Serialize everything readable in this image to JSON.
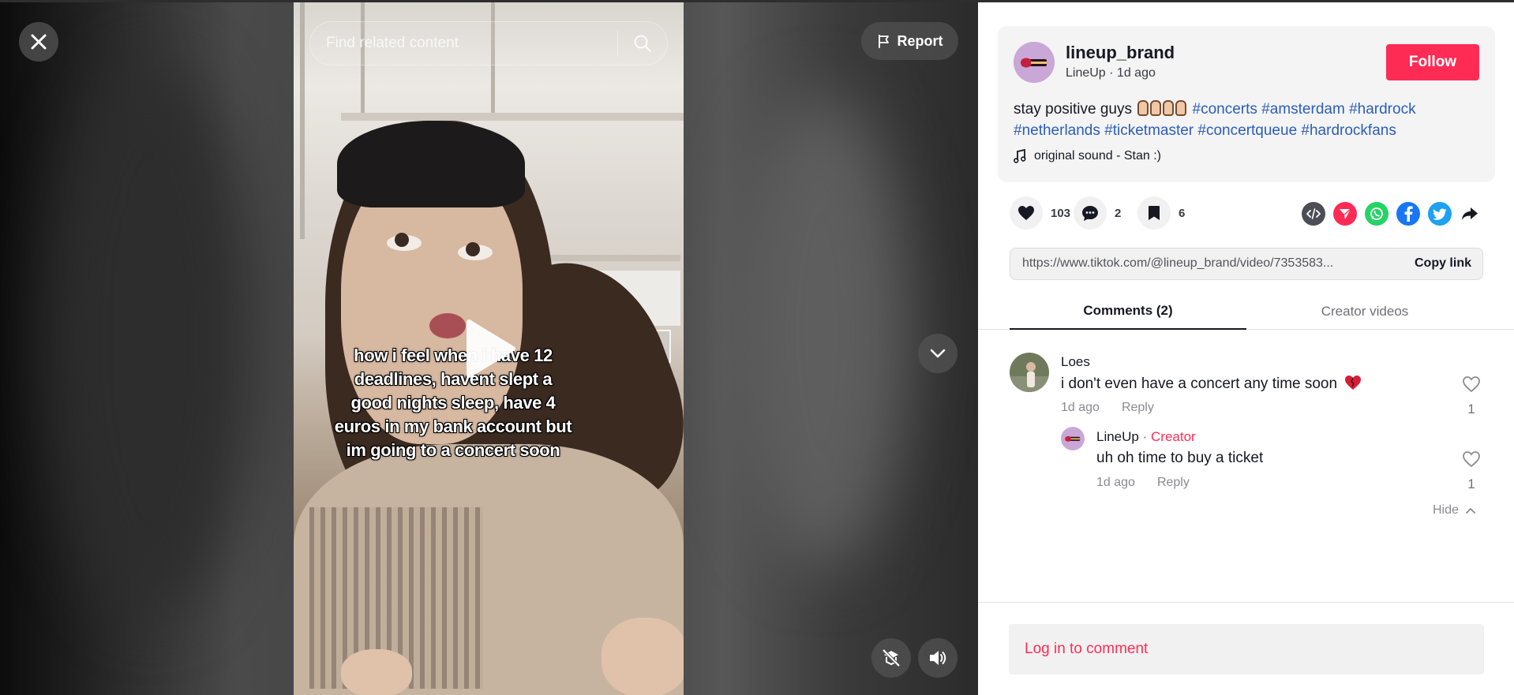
{
  "video": {
    "search_placeholder": "Find related content",
    "report_label": "Report",
    "caption": "how i feel when i have 12 deadlines, havent slept a good nights sleep, have 4 euros in my bank account but im going to a concert soon"
  },
  "post": {
    "author_handle": "lineup_brand",
    "author_sub": "LineUp · 1d ago",
    "follow_label": "Follow",
    "description_text": "stay positive guys",
    "hashtags": [
      "#concerts",
      "#amsterdam",
      "#hardrock",
      "#netherlands",
      "#ticketmaster",
      "#concertqueue",
      "#hardrockfans"
    ],
    "sound": "original sound - Stan :)"
  },
  "actions": {
    "likes": "103",
    "comments": "2",
    "saves": "6",
    "share_icons": [
      "embed-icon",
      "send-icon",
      "whatsapp-icon",
      "facebook-icon",
      "twitter-icon",
      "share-arrow-icon"
    ]
  },
  "link": {
    "url": "https://www.tiktok.com/@lineup_brand/video/7353583...",
    "copy_label": "Copy link"
  },
  "tabs": {
    "comments_label": "Comments (2)",
    "creator_videos_label": "Creator videos"
  },
  "comments": [
    {
      "name": "Loes",
      "text": "i don't even have a concert any time soon",
      "time": "1d ago",
      "reply_label": "Reply",
      "likes": "1",
      "reply": {
        "name": "LineUp",
        "sep": "·",
        "creator_tag": "Creator",
        "text": "uh oh time to buy a ticket",
        "time": "1d ago",
        "reply_label": "Reply",
        "likes": "1"
      }
    }
  ],
  "hide_label": "Hide",
  "login_label": "Log in to comment",
  "colors": {
    "accent": "#fe2c55",
    "hashtag": "#2b5db9"
  }
}
